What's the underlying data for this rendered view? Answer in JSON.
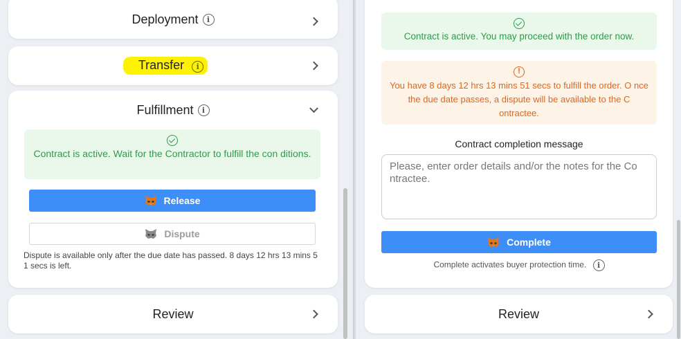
{
  "left": {
    "sections": {
      "deployment": {
        "title": "Deployment"
      },
      "transfer": {
        "title": "Transfer"
      },
      "fulfillment": {
        "title": "Fulfillment",
        "alert": "Contract is active. Wait for the Contractor to fulfill the con ditions.",
        "release_label": "Release",
        "dispute_label": "Dispute",
        "note": "Dispute is available only after the due date has passed. 8 days 12 hrs 13 mins 5 1 secs is left."
      },
      "review": {
        "title": "Review"
      }
    }
  },
  "right": {
    "alert_success": "Contract is active. You may proceed with the order now.",
    "alert_warning": "You have 8 days 12 hrs 13 mins 51 secs to fulfill the order. O nce the due date passes, a dispute will be available to the C ontractee.",
    "completion_label": "Contract completion message",
    "completion_placeholder": "Please, enter order details and/or the notes for the Co ntractee.",
    "complete_label": "Complete",
    "complete_note": "Complete activates buyer protection time.",
    "review": {
      "title": "Review"
    }
  },
  "icons": {
    "info": "i",
    "warning": "!"
  },
  "colors": {
    "primary": "#3e8ef7",
    "success_bg": "#eaf8ec",
    "success_text": "#2e9a4a",
    "warning_bg": "#fdf3e6",
    "warning_text": "#e0661e",
    "highlight": "#fff200"
  }
}
